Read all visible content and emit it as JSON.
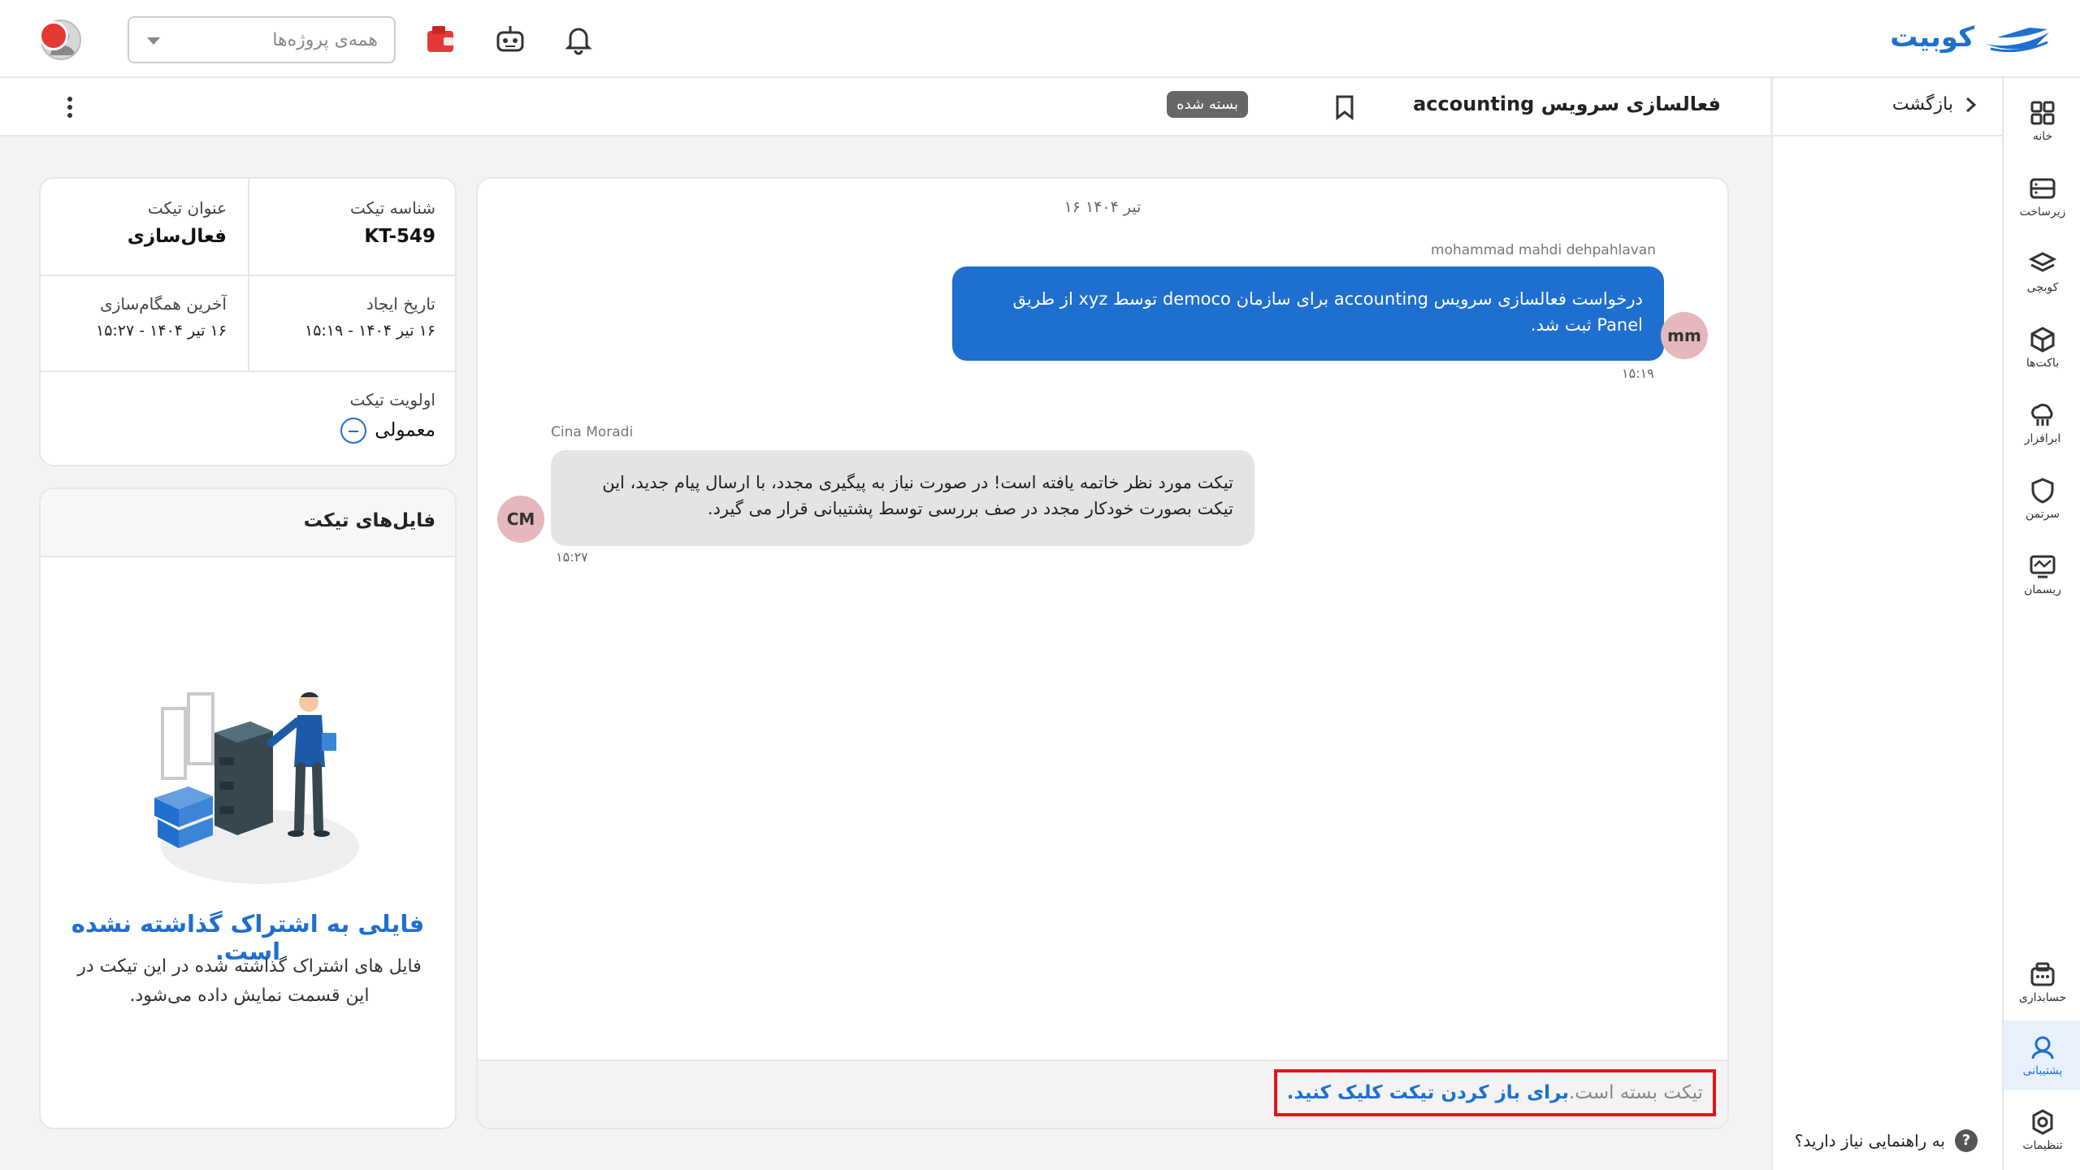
{
  "header": {
    "logo_text": "کوبیت",
    "project_select_placeholder": "همه‌ی پروژه‌ها",
    "icons": [
      "bell-icon",
      "robot-icon",
      "wallet-icon"
    ]
  },
  "sidebar": {
    "items": [
      {
        "label": "خانه",
        "icon": "grid-icon"
      },
      {
        "label": "زیرساخت",
        "icon": "server-icon"
      },
      {
        "label": "کوبچی",
        "icon": "layers-icon"
      },
      {
        "label": "باکت‌ها",
        "icon": "box-icon"
      },
      {
        "label": "ابرافزار",
        "icon": "cloud-icon"
      },
      {
        "label": "سرتمن",
        "icon": "shield-icon"
      },
      {
        "label": "ریسمان",
        "icon": "monitor-icon"
      },
      {
        "label": "حسابداری",
        "icon": "calculator-icon"
      },
      {
        "label": "پشتیبانی",
        "icon": "support-icon"
      },
      {
        "label": "تنظیمات",
        "icon": "gear-icon"
      }
    ],
    "active_item": "پشتیبانی"
  },
  "back_panel": {
    "back_label": "بازگشت",
    "help_label": "به راهنمایی نیاز دارید؟",
    "help_glyph": "?"
  },
  "ticket": {
    "title": "فعالسازی سرویس accounting",
    "status_badge": "بسته شده",
    "id_label": "شناسه تیکت",
    "id_value": "KT-549",
    "subject_label": "عنوان تیکت",
    "subject_value": "فعال‌سازی",
    "created_label": "تاریخ ایجاد",
    "created_value": "۱۶ تیر ۱۴۰۴ - ۱۵:۱۹",
    "synced_label": "آخرین همگام‌سازی",
    "synced_value": "۱۶ تیر ۱۴۰۴ - ۱۵:۲۷",
    "priority_label": "اولویت تیکت",
    "priority_value": "معمولی"
  },
  "chat": {
    "date": "۱۶ تیر ۱۴۰۴",
    "messages": [
      {
        "sender": "mohammad mahdi dehpahlavan",
        "initials": "mm",
        "text": "درخواست فعالسازی سرویس accounting برای سازمان democo توسط xyz از طریق Panel ثبت شد.",
        "time": "۱۵:۱۹"
      },
      {
        "sender": "Cina Moradi",
        "initials": "CM",
        "text": "تیکت مورد نظر خاتمه یافته است! در صورت نیاز به پیگیری مجدد، با ارسال پیام جدید، این تیکت بصورت خودکار مجدد در صف بررسی توسط پشتیبانی قرار می گیرد.",
        "time": "۱۵:۲۷"
      }
    ],
    "closed_text": "تیکت بسته است.",
    "reopen_link": "برای باز کردن تیکت کلیک کنید."
  },
  "files": {
    "title": "فایل‌های تیکت",
    "empty_title": "فایلی به اشتراک گذاشته نشده است.",
    "empty_desc": "فایل های اشتراک گذاشته شده در این تیکت در این قسمت نمایش داده می‌شود."
  },
  "colors": {
    "accent": "#1e6fcf",
    "closed_badge": "#666666",
    "highlight_border": "#e0161c",
    "avatar": "#e6b7bd"
  }
}
